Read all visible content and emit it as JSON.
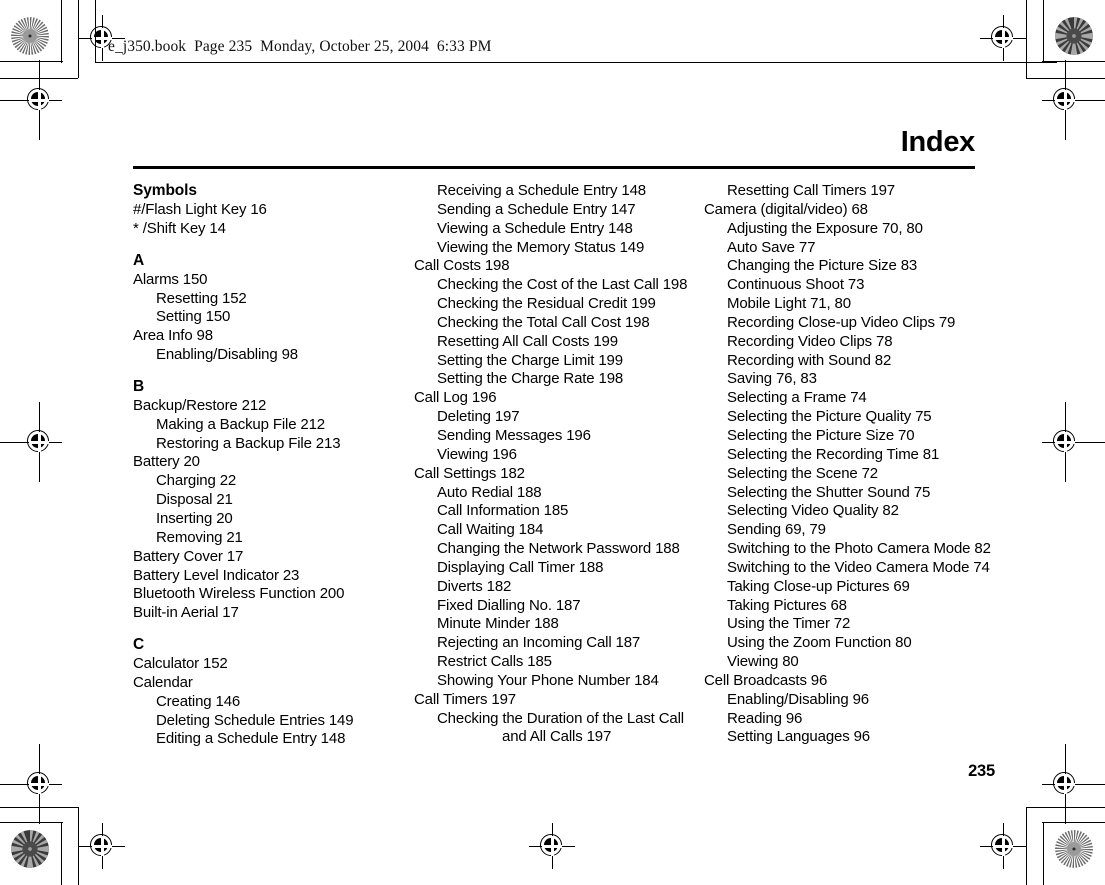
{
  "document": {
    "header_line": "e_j350.book  Page 235  Monday, October 25, 2004  6:33 PM",
    "page_title": "Index",
    "page_number": "235"
  },
  "marks": {
    "star_target": "radial-star-target",
    "registration": "registration-crosshair",
    "crop": "crop-mark"
  },
  "index": {
    "columns": [
      {
        "id": "column-1",
        "blocks": [
          {
            "heading": "Symbols",
            "entries": [
              {
                "text": "#/Flash Light Key 16",
                "level": 1
              },
              {
                "text": "* /Shift Key 14",
                "level": 1
              }
            ]
          },
          {
            "heading": "A",
            "entries": [
              {
                "text": "Alarms 150",
                "level": 1
              },
              {
                "text": "Resetting 152",
                "level": 2
              },
              {
                "text": "Setting 150",
                "level": 2
              },
              {
                "text": "Area Info 98",
                "level": 1
              },
              {
                "text": "Enabling/Disabling 98",
                "level": 2
              }
            ]
          },
          {
            "heading": "B",
            "entries": [
              {
                "text": "Backup/Restore 212",
                "level": 1
              },
              {
                "text": "Making a Backup File 212",
                "level": 2
              },
              {
                "text": "Restoring a Backup File 213",
                "level": 2
              },
              {
                "text": "Battery 20",
                "level": 1
              },
              {
                "text": "Charging 22",
                "level": 2
              },
              {
                "text": "Disposal 21",
                "level": 2
              },
              {
                "text": "Inserting 20",
                "level": 2
              },
              {
                "text": "Removing 21",
                "level": 2
              },
              {
                "text": "Battery Cover 17",
                "level": 1
              },
              {
                "text": "Battery Level Indicator 23",
                "level": 1
              },
              {
                "text": "Bluetooth Wireless Function 200",
                "level": 1
              },
              {
                "text": "Built-in Aerial 17",
                "level": 1
              }
            ]
          },
          {
            "heading": "C",
            "entries": [
              {
                "text": "Calculator 152",
                "level": 1
              },
              {
                "text": "Calendar",
                "level": 1
              },
              {
                "text": "Creating 146",
                "level": 2
              },
              {
                "text": "Deleting Schedule Entries 149",
                "level": 2
              },
              {
                "text": "Editing a Schedule Entry 148",
                "level": 2
              }
            ]
          }
        ]
      },
      {
        "id": "column-2",
        "blocks": [
          {
            "heading": null,
            "entries": [
              {
                "text": "Receiving a Schedule Entry 148",
                "level": 2
              },
              {
                "text": "Sending a Schedule Entry 147",
                "level": 2
              },
              {
                "text": "Viewing a Schedule Entry 148",
                "level": 2
              },
              {
                "text": "Viewing the Memory Status 149",
                "level": 2
              },
              {
                "text": "Call Costs 198",
                "level": 1
              },
              {
                "text": "Checking the Cost of the Last Call 198",
                "level": 2
              },
              {
                "text": "Checking the Residual Credit 199",
                "level": 2
              },
              {
                "text": "Checking the Total Call Cost 198",
                "level": 2
              },
              {
                "text": "Resetting All Call Costs 199",
                "level": 2
              },
              {
                "text": "Setting the Charge Limit 199",
                "level": 2
              },
              {
                "text": "Setting the Charge Rate 198",
                "level": 2
              },
              {
                "text": "Call Log 196",
                "level": 1
              },
              {
                "text": "Deleting 197",
                "level": 2
              },
              {
                "text": "Sending Messages 196",
                "level": 2
              },
              {
                "text": "Viewing 196",
                "level": 2
              },
              {
                "text": "Call Settings 182",
                "level": 1
              },
              {
                "text": "Auto Redial 188",
                "level": 2
              },
              {
                "text": "Call Information 185",
                "level": 2
              },
              {
                "text": "Call Waiting 184",
                "level": 2
              },
              {
                "text": "Changing the Network Password 188",
                "level": 2
              },
              {
                "text": "Displaying Call Timer 188",
                "level": 2
              },
              {
                "text": "Diverts 182",
                "level": 2
              },
              {
                "text": "Fixed Dialling No. 187",
                "level": 2
              },
              {
                "text": "Minute Minder 188",
                "level": 2
              },
              {
                "text": "Rejecting an Incoming Call 187",
                "level": 2
              },
              {
                "text": "Restrict Calls 185",
                "level": 2
              },
              {
                "text": "Showing Your Phone Number 184",
                "level": 2
              },
              {
                "text": "Call Timers 197",
                "level": 1
              },
              {
                "text": "Checking the Duration of the Last Call",
                "level": 2
              },
              {
                "text": "and All Calls 197",
                "level": 3
              }
            ]
          }
        ]
      },
      {
        "id": "column-3",
        "blocks": [
          {
            "heading": null,
            "entries": [
              {
                "text": "Resetting Call Timers 197",
                "level": 2
              },
              {
                "text": "Camera (digital/video) 68",
                "level": 1
              },
              {
                "text": "Adjusting the Exposure 70, 80",
                "level": 2
              },
              {
                "text": "Auto Save 77",
                "level": 2
              },
              {
                "text": "Changing the Picture Size 83",
                "level": 2
              },
              {
                "text": "Continuous Shoot 73",
                "level": 2
              },
              {
                "text": "Mobile Light 71, 80",
                "level": 2
              },
              {
                "text": "Recording Close-up Video Clips 79",
                "level": 2
              },
              {
                "text": "Recording Video Clips 78",
                "level": 2
              },
              {
                "text": "Recording with Sound 82",
                "level": 2
              },
              {
                "text": "Saving 76, 83",
                "level": 2
              },
              {
                "text": "Selecting a Frame 74",
                "level": 2
              },
              {
                "text": "Selecting the Picture Quality 75",
                "level": 2
              },
              {
                "text": "Selecting the Picture Size 70",
                "level": 2
              },
              {
                "text": "Selecting the Recording Time 81",
                "level": 2
              },
              {
                "text": "Selecting the Scene 72",
                "level": 2
              },
              {
                "text": "Selecting the Shutter Sound 75",
                "level": 2
              },
              {
                "text": "Selecting Video Quality 82",
                "level": 2
              },
              {
                "text": "Sending 69, 79",
                "level": 2
              },
              {
                "text": "Switching to the Photo Camera Mode 82",
                "level": 2
              },
              {
                "text": "Switching to the Video Camera Mode 74",
                "level": 2
              },
              {
                "text": "Taking Close-up Pictures 69",
                "level": 2
              },
              {
                "text": "Taking Pictures 68",
                "level": 2
              },
              {
                "text": "Using the Timer 72",
                "level": 2
              },
              {
                "text": "Using the Zoom Function 80",
                "level": 2
              },
              {
                "text": "Viewing 80",
                "level": 2
              },
              {
                "text": "Cell Broadcasts 96",
                "level": 1
              },
              {
                "text": "Enabling/Disabling 96",
                "level": 2
              },
              {
                "text": "Reading 96",
                "level": 2
              },
              {
                "text": "Setting Languages 96",
                "level": 2
              }
            ]
          }
        ]
      }
    ]
  }
}
